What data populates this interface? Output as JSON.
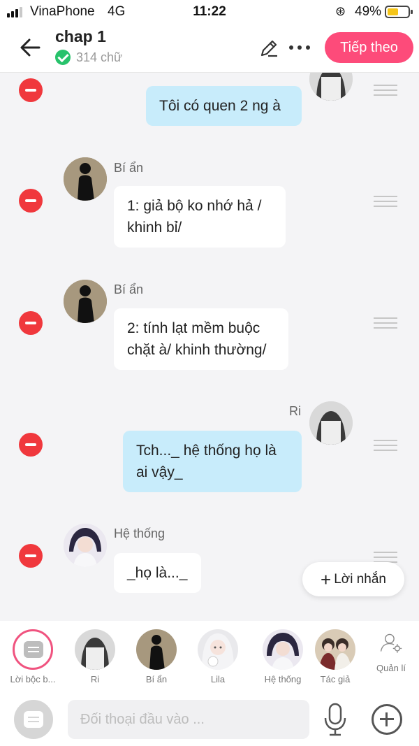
{
  "status_bar": {
    "carrier": "VinaPhone",
    "network": "4G",
    "time": "11:22",
    "battery": "49%"
  },
  "header": {
    "title": "chap 1",
    "word_count": "314 chữ",
    "next_button": "Tiếp theo"
  },
  "messages": [
    {
      "side": "right",
      "speaker": "",
      "text": "Tôi có quen 2 ng à"
    },
    {
      "side": "left",
      "speaker": "Bí ẩn",
      "text": "1: giả bộ ko nhớ hả /\nkhinh bỉ/"
    },
    {
      "side": "left",
      "speaker": "Bí ẩn",
      "text": "2: tính lạt mềm buộc\nchặt à/ khinh thường/"
    },
    {
      "side": "right",
      "speaker": "Ri",
      "text": "Tch..._ hệ thống họ là\nai vậy_"
    },
    {
      "side": "left",
      "speaker": "Hệ thống",
      "text": "_họ là..._"
    }
  ],
  "note_button": "Lời nhắn",
  "characters": [
    {
      "label": "Lời bộc b...",
      "icon": "narration-icon"
    },
    {
      "label": "Ri",
      "icon": "ri-avatar"
    },
    {
      "label": "Bí ẩn",
      "icon": "mystery-avatar"
    },
    {
      "label": "Lila",
      "icon": "lila-avatar"
    },
    {
      "label": "Hệ thống",
      "icon": "system-avatar"
    },
    {
      "label": "Tác giả",
      "icon": "author-avatar"
    },
    {
      "label": "Quản lí",
      "icon": "manage-icon"
    }
  ],
  "input": {
    "placeholder": "Đối thoại đầu vào ..."
  }
}
